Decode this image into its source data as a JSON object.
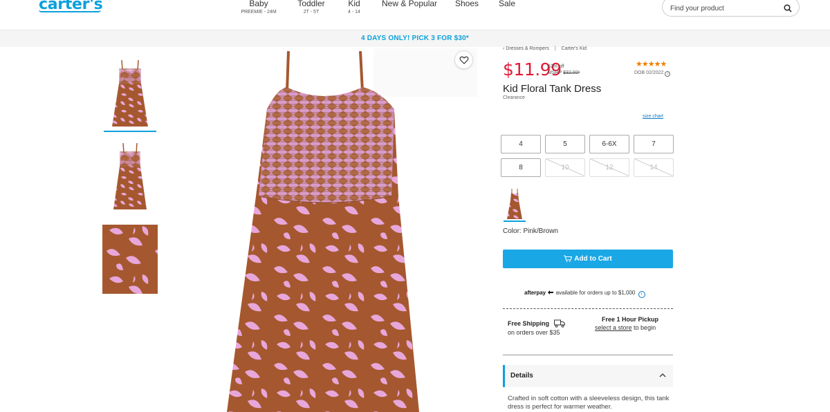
{
  "header": {
    "logo": "carter's",
    "nav": [
      {
        "label": "Baby",
        "sub": "PREEMIE - 24M"
      },
      {
        "label": "Toddler",
        "sub": "2T - 5T"
      },
      {
        "label": "Kid",
        "sub": "4 - 14"
      },
      {
        "label": "New & Popular",
        "sub": ""
      },
      {
        "label": "Shoes",
        "sub": ""
      },
      {
        "label": "Sale",
        "sub": ""
      }
    ],
    "search_placeholder": "Find your product"
  },
  "promo": "4 DAYS ONLY! PICK 3 FOR $30*",
  "breadcrumb": {
    "item1": "‹ Dresses & Rompers",
    "sep": "|",
    "item2": "Carter's  Kid"
  },
  "product": {
    "price": "$11.99",
    "percent_off": "63% off",
    "msrp_label": "MSRP",
    "msrp_value": "$32.00*",
    "stars": "★★★★★",
    "dob": "DOB 02/2022",
    "title": "Kid Floral Tank Dress",
    "status": "Clearance",
    "size_chart": "size chart",
    "sizes": [
      {
        "label": "4",
        "available": true
      },
      {
        "label": "5",
        "available": true
      },
      {
        "label": "6-6X",
        "available": true
      },
      {
        "label": "7",
        "available": true
      },
      {
        "label": "8",
        "available": true
      },
      {
        "label": "10",
        "available": false
      },
      {
        "label": "12",
        "available": false
      },
      {
        "label": "14",
        "available": false
      }
    ],
    "color_label": "Color: Pink/Brown",
    "add_to_cart": "Add to Cart",
    "afterpay_brand": "afterpay",
    "afterpay_text": "available for orders up to $1,000",
    "shipping_title": "Free Shipping",
    "shipping_sub": "on orders over $35",
    "pickup_title": "Free 1 Hour Pickup",
    "pickup_link": "select a store",
    "pickup_tail": "to begin",
    "details_label": "Details",
    "description": "Crafted in soft cotton with a sleeveless design, this tank dress is perfect for warmer weather."
  },
  "colors": {
    "brand_blue": "#0aa1dc",
    "price_red": "#e21936",
    "dress_brown": "#a5582f",
    "dress_pink": "#e8a7da"
  }
}
